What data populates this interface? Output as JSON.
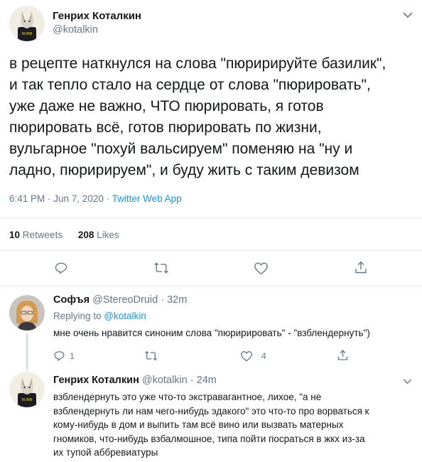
{
  "main_tweet": {
    "author_name": "Генрих Коталкин",
    "handle": "@kotalkin",
    "text_lines": [
      "в рецепте наткнулся на слова \"пюририруйте базилик\",",
      "и так тепло стало на сердце от слова \"пюрировать\",",
      "уже даже не важно, ЧТО пюрировать, я готов",
      "пюрировать всё, готов пюрировать по жизни,",
      "вульгарное \"похуй вальсируем\" поменяю на \"ну и",
      "ладно, пюририруем\", и буду жить с таким девизом"
    ],
    "timestamp": "6:41 PM · Jun 7, 2020 · ",
    "source": "Twitter Web App",
    "retweets_count": "10",
    "retweets_label": "Retweets",
    "likes_count": "208",
    "likes_label": "Likes",
    "avatar_text": "RUNN"
  },
  "reply1": {
    "author_name": "Софъя",
    "handle": "@StereoDruid",
    "time": " · 32m",
    "replying_label": "Replying to ",
    "replying_to": "@kotalkin",
    "text": "мне очень нравится синоним слова \"пюририровать\" - \"взблендернуть\")",
    "reply_count": "1",
    "like_count": "4"
  },
  "reply2": {
    "author_name": "Генрих Коталкин",
    "handle": "@kotalkin",
    "time": " · 24m",
    "text_lines": [
      "взблендернуть это уже что-то экстравагантное, лихое, \"а не",
      "взблендернуть ли нам чего-нибудь эдакого\" это что-то про ворваться к",
      "кому-нибудь в дом и выпить там всё вино или вызвать матерных",
      "гномиков, что-нибудь взбалмошное, типа пойти посраться в жкх из-за",
      "их тупой аббревиатуры"
    ],
    "avatar_text": "RUNN"
  },
  "colors": {
    "accent": "#1b95e0",
    "text": "#14171a",
    "muted": "#657786",
    "border": "#e1e8ed"
  }
}
